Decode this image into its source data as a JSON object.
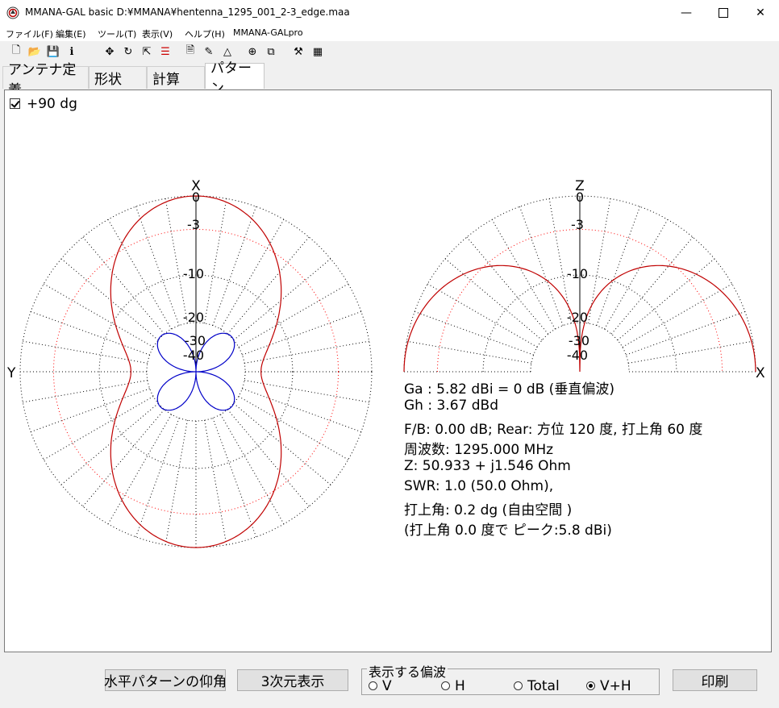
{
  "window": {
    "title": "MMANA-GAL basic D:¥MMANA¥hentenna_1295_001_2-3_edge.maa"
  },
  "menu": [
    "ファイル(F)",
    "編集(E)",
    "ツール(T)",
    "表示(V)",
    "ヘルプ(H)",
    "MMANA-GALpro"
  ],
  "tabs": [
    "アンテナ定義",
    "形状",
    "計算",
    "パターン"
  ],
  "active_tab": "パターン",
  "checkbox": {
    "label": "+90 dg",
    "checked": true
  },
  "horizontal_plot": {
    "top_label": "X",
    "left_label": "Y",
    "ring_labels": [
      "0",
      "-3",
      "-10",
      "-20",
      "-30",
      "-40"
    ]
  },
  "vertical_plot": {
    "top_label": "Z",
    "right_label": "X",
    "ring_labels": [
      "0",
      "-3",
      "-10",
      "-20",
      "-30",
      "-40"
    ]
  },
  "info": {
    "ga": "Ga : 5.82 dBi = 0 dB  (垂直偏波)",
    "gh": "Gh : 3.67 dBd",
    "fb": "F/B: 0.00 dB; Rear: 方位 120 度,  打上角 60 度",
    "freq": "周波数: 1295.000 MHz",
    "z": "Z: 50.933 + j1.546 Ohm",
    "swr": "SWR: 1.0 (50.0 Ohm),",
    "elev": "打上角: 0.2 dg (自由空間 )",
    "peak": "(打上角 0.0 度で ピーク:5.8 dBi)"
  },
  "buttons": {
    "elev_pattern": "水平パターンの仰角",
    "view3d": "3次元表示",
    "print": "印刷"
  },
  "polarization": {
    "title": "表示する偏波",
    "options": [
      "V",
      "H",
      "Total",
      "V+H"
    ],
    "selected": "V+H"
  },
  "colors": {
    "red_pattern": "#c00000",
    "blue_pattern": "#0000c8",
    "grid_red": "#ff0000"
  }
}
